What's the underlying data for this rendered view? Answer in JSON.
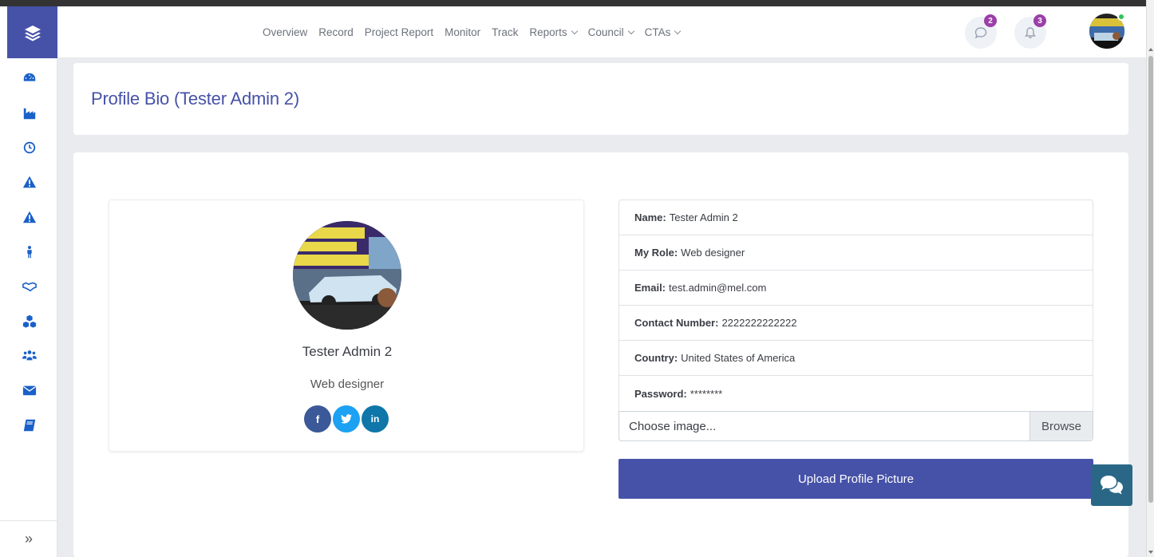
{
  "nav": {
    "items": [
      {
        "label": "Overview",
        "dropdown": false
      },
      {
        "label": "Record",
        "dropdown": false
      },
      {
        "label": "Project Report",
        "dropdown": false
      },
      {
        "label": "Monitor",
        "dropdown": false
      },
      {
        "label": "Track",
        "dropdown": false
      },
      {
        "label": "Reports",
        "dropdown": true
      },
      {
        "label": "Council",
        "dropdown": true
      },
      {
        "label": "CTAs",
        "dropdown": true
      }
    ]
  },
  "header": {
    "messages_count": "2",
    "notifications_count": "3"
  },
  "sidebar": {
    "icons": [
      "dashboard-icon",
      "industry-icon",
      "clock-icon",
      "warning-icon",
      "warning-icon",
      "person-icon",
      "handshake-icon",
      "cubes-icon",
      "users-icon",
      "envelope-icon",
      "book-icon"
    ],
    "expand_glyph": "»"
  },
  "page": {
    "title": "Profile Bio (Tester Admin 2)"
  },
  "profile": {
    "name": "Tester Admin 2",
    "role": "Web designer",
    "socials": {
      "facebook": "f",
      "twitter": "t",
      "linkedin": "in"
    }
  },
  "details": [
    {
      "label": "Name:",
      "value": "Tester Admin 2"
    },
    {
      "label": "My Role:",
      "value": "Web designer"
    },
    {
      "label": "Email:",
      "value": "test.admin@mel.com"
    },
    {
      "label": "Contact Number:",
      "value": "2222222222222"
    },
    {
      "label": "Country:",
      "value": "United States of America"
    },
    {
      "label": "Password:",
      "value": "********"
    }
  ],
  "upload": {
    "placeholder": "Choose image...",
    "browse_label": "Browse",
    "button_label": "Upload Profile Picture"
  },
  "colors": {
    "primary": "#4652a8",
    "sidebar_icon": "#1a60c9",
    "badge": "#9b3fa8",
    "online": "#2fc35a",
    "chat_fab": "#2a6786"
  }
}
